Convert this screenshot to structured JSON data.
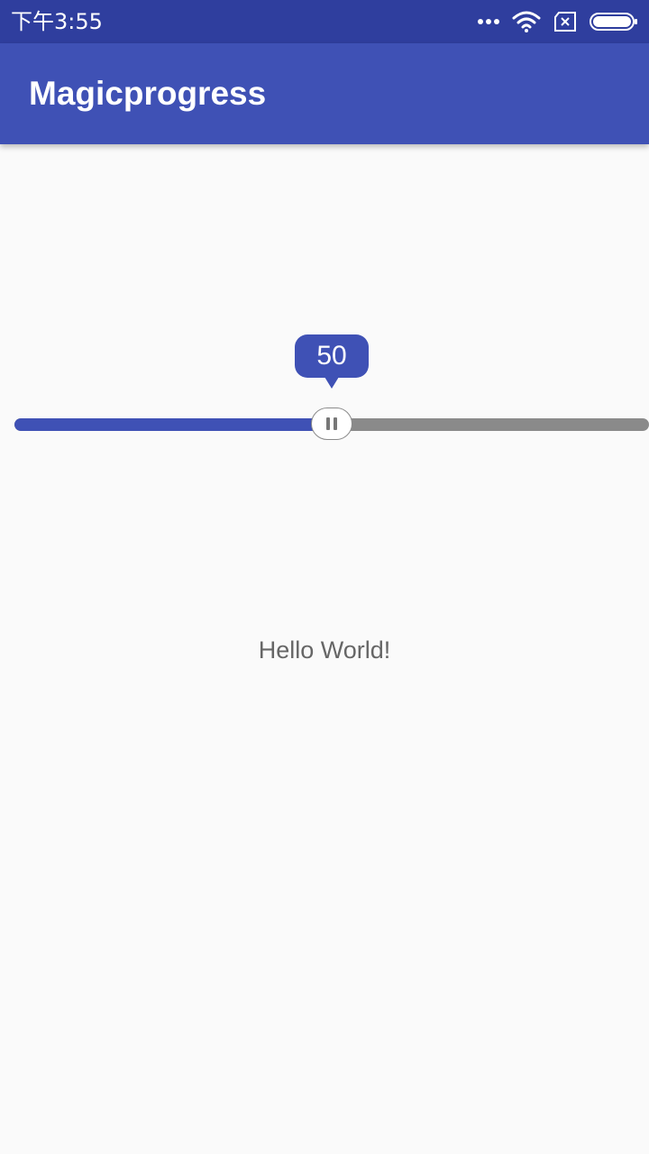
{
  "status_bar": {
    "time": "下午3:55",
    "icons": [
      "more-dots-icon",
      "wifi-icon",
      "no-sim-icon",
      "battery-icon"
    ]
  },
  "app_bar": {
    "title": "Magicprogress",
    "color": "#3f51b5"
  },
  "progress": {
    "value": 50,
    "value_label": "50",
    "max": 100,
    "fill_color": "#3f51b5",
    "track_color": "#8a8a8a",
    "thumb_icon": "pause-icon"
  },
  "content": {
    "hello_text": "Hello World!"
  }
}
